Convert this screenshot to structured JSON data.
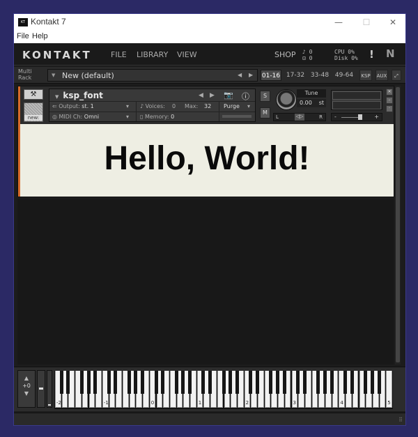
{
  "window": {
    "title": "Kontakt 7",
    "app_icon_text": "KT"
  },
  "menubar": {
    "items": [
      "File",
      "Help"
    ]
  },
  "kontakt_bar": {
    "logo": "KONTAKT",
    "nav": [
      "FILE",
      "LIBRARY",
      "VIEW"
    ],
    "shop": "SHOP",
    "midi_line1": "♪ 0",
    "midi_line2": "⊡ 0",
    "cpu": "CPU 0%",
    "disk": "Disk 0%",
    "warning": "!",
    "ni_logo": "N"
  },
  "rack": {
    "label_line1": "Multi",
    "label_line2": "Rack",
    "multi_name": "New (default)",
    "tabs": [
      "01-16",
      "17-32",
      "33-48",
      "49-64"
    ],
    "active_tab": "01-16",
    "small_tabs": [
      "KSP",
      "AUX"
    ]
  },
  "instrument": {
    "name": "ksp_font",
    "output_label": "Output:",
    "output_value": "st. 1",
    "voices_label": "Voices:",
    "voices_value": "0",
    "max_label": "Max:",
    "max_value": "32",
    "purge_label": "Purge",
    "midi_label": "MIDI Ch:",
    "midi_value": "Omni",
    "memory_label": "Memory:",
    "memory_value": "0",
    "thumbnail_label": "new:",
    "solo_label": "S",
    "mute_label": "M",
    "tune_label": "Tune",
    "tune_value": "0.00",
    "tune_unit": "st",
    "pan_left": "L",
    "pan_right": "R",
    "pan_center": "◁▷",
    "vol_minus": "-",
    "vol_plus": "+",
    "ui_text": "Hello, World!"
  },
  "keyboard": {
    "octave_value": "+0",
    "octave_labels": [
      "-2",
      "-1",
      "0",
      "1",
      "2",
      "3",
      "4",
      "5"
    ]
  },
  "colors": {
    "accent_stripe": "#d86a2a",
    "instrument_ui_bg": "#eeeee3",
    "desktop_bg": "#2b2965"
  }
}
